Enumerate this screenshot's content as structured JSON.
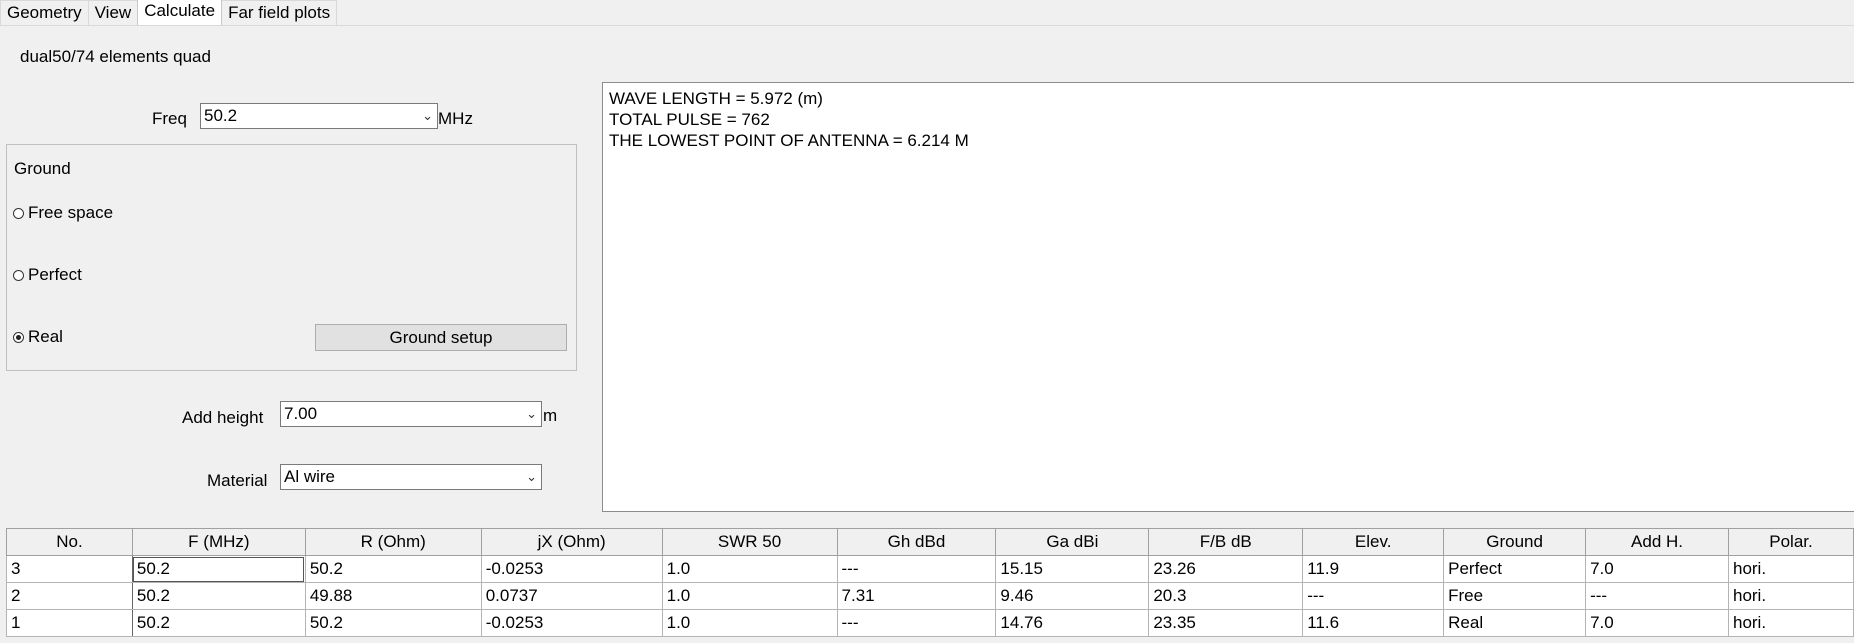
{
  "tabs": [
    "Geometry",
    "View",
    "Calculate",
    "Far field plots"
  ],
  "project_name": "dual50/74 elements quad",
  "freq": {
    "label": "Freq",
    "value": "50.2",
    "unit": "MHz"
  },
  "ground": {
    "title": "Ground",
    "options": [
      "Free space",
      "Perfect",
      "Real"
    ],
    "selected": "Real",
    "setup_button": "Ground setup"
  },
  "add_height": {
    "label": "Add height",
    "value": "7.00",
    "unit": "m"
  },
  "material": {
    "label": "Material",
    "value": "Al wire"
  },
  "output_lines": [
    "WAVE LENGTH = 5.972 (m)",
    "TOTAL PULSE = 762",
    "THE LOWEST POINT OF ANTENNA = 6.214 M"
  ],
  "table": {
    "columns": [
      "No.",
      "F (MHz)",
      "R (Ohm)",
      "jX (Ohm)",
      "SWR 50",
      "Gh dBd",
      "Ga dBi",
      "F/B dB",
      "Elev.",
      "Ground",
      "Add H.",
      "Polar."
    ],
    "rows": [
      [
        "3",
        "50.2",
        "50.2",
        "-0.0253",
        "1.0",
        "---",
        "15.15",
        "23.26",
        "11.9",
        "Perfect",
        "7.0",
        "hori."
      ],
      [
        "2",
        "50.2",
        "49.88",
        "0.0737",
        "1.0",
        "7.31",
        "9.46",
        "20.3",
        " ---",
        "Free",
        " ---",
        "hori."
      ],
      [
        "1",
        "50.2",
        "50.2",
        "-0.0253",
        "1.0",
        "---",
        "14.76",
        "23.35",
        "11.6",
        "Real",
        "7.0",
        "hori."
      ]
    ]
  },
  "colors": {
    "window_bg": "#f0f0f0",
    "field_bg": "#ffffff",
    "border": "#7a7a7a"
  }
}
